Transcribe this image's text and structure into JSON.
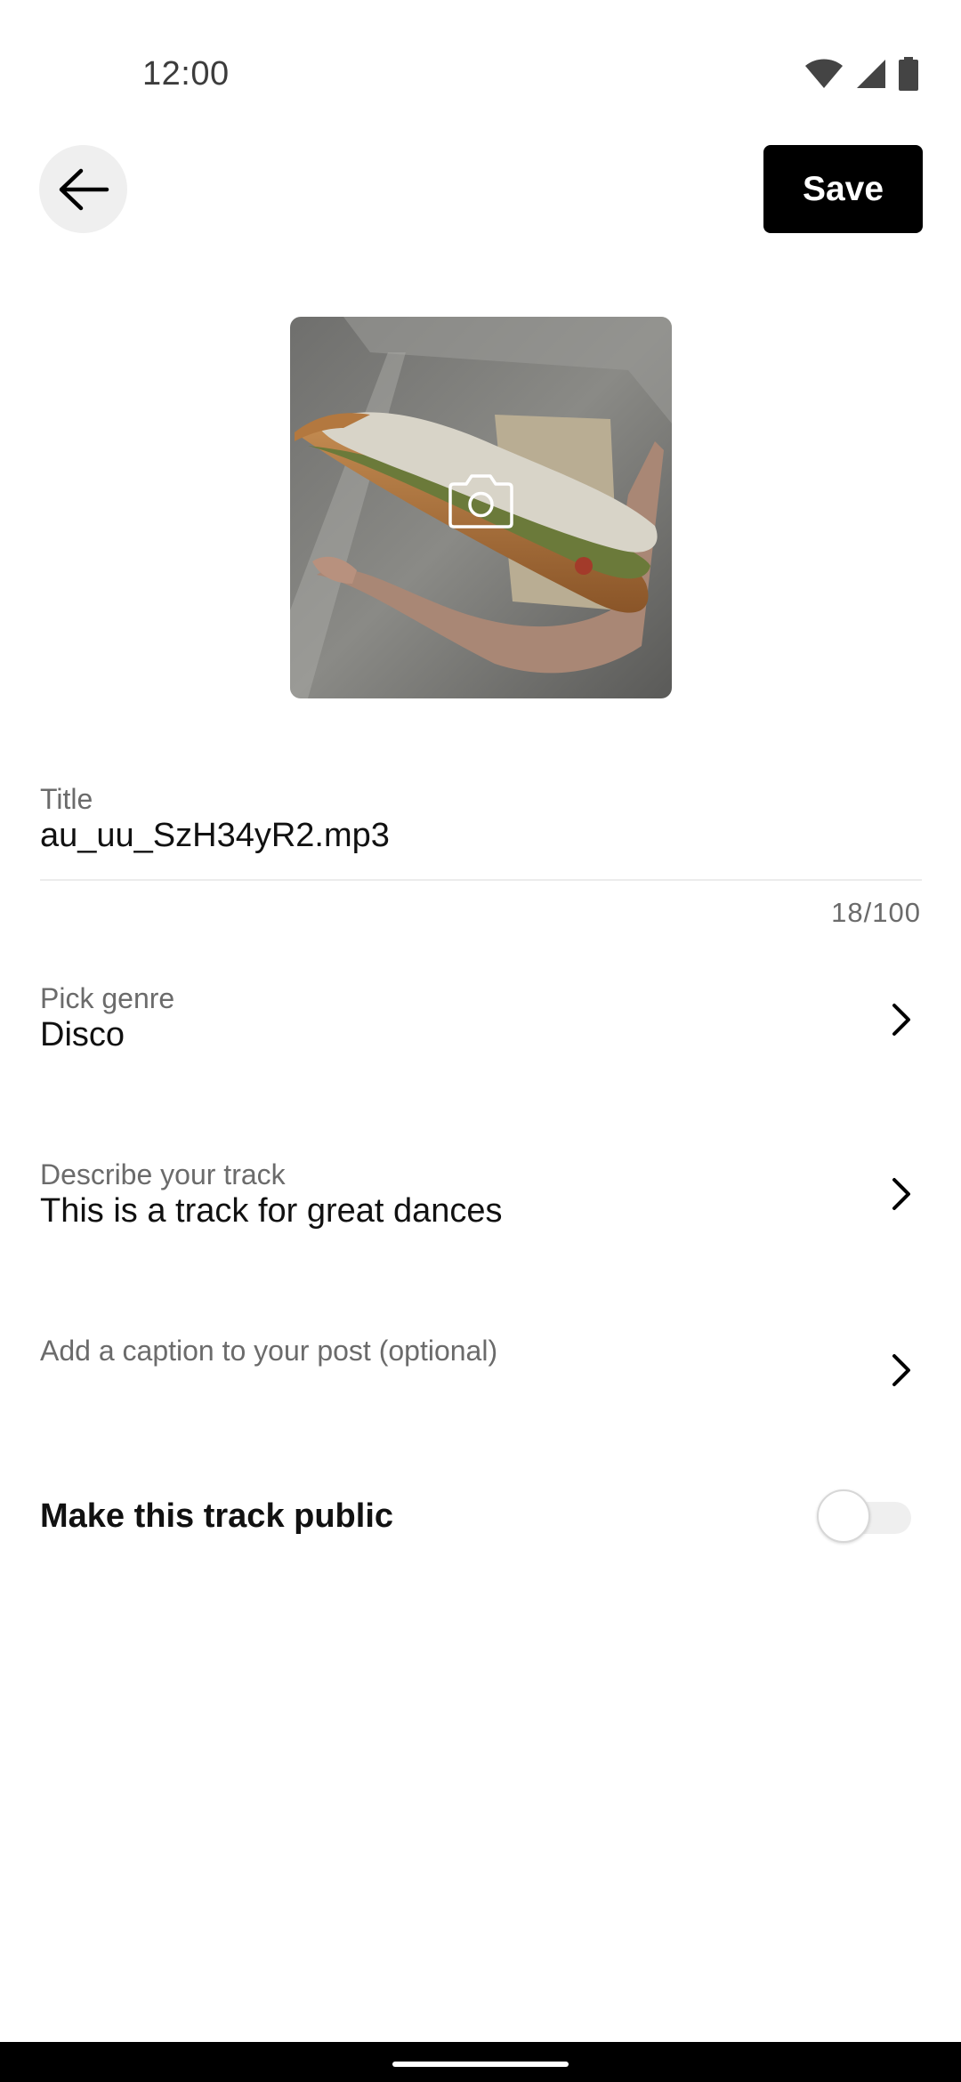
{
  "status_bar": {
    "time": "12:00",
    "icons": [
      "wifi-icon",
      "cell-signal-icon",
      "battery-icon"
    ]
  },
  "toolbar": {
    "back_icon": "arrow-left-icon",
    "save_label": "Save"
  },
  "cover": {
    "overlay_icon": "camera-icon"
  },
  "title_field": {
    "label": "Title",
    "value": "au_uu_SzH34yR2.mp3",
    "counter": "18/100"
  },
  "genre_row": {
    "label": "Pick genre",
    "value": "Disco"
  },
  "description_row": {
    "label": "Describe your track",
    "value": "This is a track for great dances"
  },
  "caption_row": {
    "label": "Add a caption to your post (optional)"
  },
  "public_toggle": {
    "label": "Make this track public",
    "checked": false
  },
  "colors": {
    "accent": "#000000",
    "muted_text": "#6b6b6b",
    "back_button_bg": "#efefef"
  }
}
